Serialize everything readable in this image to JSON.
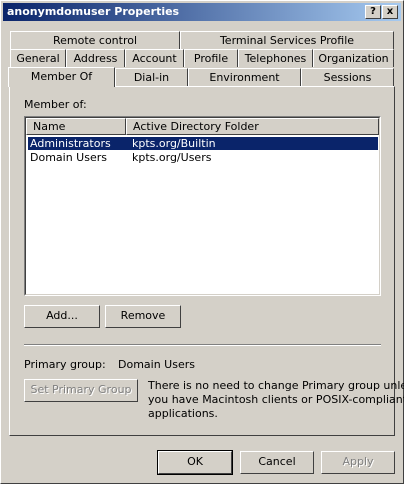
{
  "window": {
    "title": "anonymdomuser Properties",
    "help_label": "?",
    "close_label": "x"
  },
  "tabs": {
    "row1": [
      "Remote control",
      "Terminal Services Profile"
    ],
    "row2": [
      "General",
      "Address",
      "Account",
      "Profile",
      "Telephones",
      "Organization"
    ],
    "row3": [
      "Member Of",
      "Dial-in",
      "Environment",
      "Sessions"
    ],
    "active": "Member Of"
  },
  "member_of": {
    "label": "Member of:",
    "columns": [
      "Name",
      "Active Directory Folder"
    ],
    "rows": [
      {
        "name": "Administrators",
        "folder": "kpts.org/Builtin",
        "selected": true
      },
      {
        "name": "Domain Users",
        "folder": "kpts.org/Users",
        "selected": false
      }
    ],
    "add_label": "Add...",
    "remove_label": "Remove"
  },
  "primary_group": {
    "label": "Primary group:",
    "value": "Domain Users",
    "set_button_label": "Set Primary Group",
    "note_line1": "There is no need to change Primary group unless",
    "note_line2": "you have Macintosh clients or POSIX-compliant",
    "note_line3": "applications."
  },
  "footer": {
    "ok_label": "OK",
    "cancel_label": "Cancel",
    "apply_label": "Apply"
  },
  "colors": {
    "face": "#d4d0c8",
    "title_start": "#0a246a",
    "title_end": "#a6caf0",
    "selection": "#0a246a"
  }
}
